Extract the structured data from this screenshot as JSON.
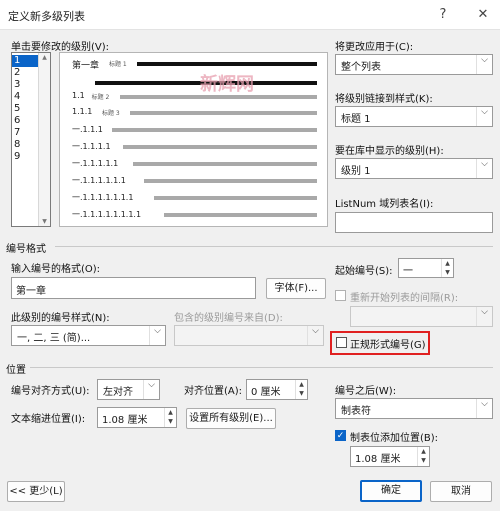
{
  "window": {
    "title": "定义新多级列表",
    "help": "?",
    "close": "✕"
  },
  "level_section": {
    "label": "单击要修改的级别(V):",
    "levels": [
      "1",
      "2",
      "3",
      "4",
      "5",
      "6",
      "7",
      "8",
      "9"
    ],
    "selected_level": "1"
  },
  "preview": {
    "rows": [
      {
        "text": "第一章",
        "style": "标题 1"
      },
      {
        "text": "",
        "style": ""
      },
      {
        "text": "1.1",
        "style": "标题 2"
      },
      {
        "text": "1.1.1",
        "style": "标题 3"
      },
      {
        "text": "一.1.1.1",
        "style": ""
      },
      {
        "text": "一.1.1.1.1",
        "style": ""
      },
      {
        "text": "一.1.1.1.1.1",
        "style": ""
      },
      {
        "text": "一.1.1.1.1.1.1",
        "style": ""
      },
      {
        "text": "一.1.1.1.1.1.1.1",
        "style": ""
      },
      {
        "text": "一.1.1.1.1.1.1.1.1",
        "style": ""
      }
    ]
  },
  "watermark": "新辉网",
  "right_panel": {
    "apply_to_label": "将更改应用于(C):",
    "apply_to_value": "整个列表",
    "link_style_label": "将级别链接到样式(K):",
    "link_style_value": "标题 1",
    "gallery_level_label": "要在库中显示的级别(H):",
    "gallery_level_value": "级别 1",
    "listnum_label": "ListNum 域列表名(I):",
    "listnum_value": ""
  },
  "number_format": {
    "section_title": "编号格式",
    "enter_format_label": "输入编号的格式(O):",
    "enter_format_value": "第一章",
    "font_button": "字体(F)...",
    "start_at_label": "起始编号(S):",
    "start_at_value": "一",
    "restart_label": "重新开始列表的间隔(R):",
    "number_style_label": "此级别的编号样式(N):",
    "number_style_value": "一, 二, 三 (简)...",
    "include_level_label": "包含的级别编号来自(D):",
    "legal_style_label": "正规形式编号(G)"
  },
  "position": {
    "section_title": "位置",
    "alignment_label": "编号对齐方式(U):",
    "alignment_value": "左对齐",
    "aligned_at_label": "对齐位置(A):",
    "aligned_at_value": "0 厘米",
    "follow_label": "编号之后(W):",
    "follow_value": "制表符",
    "indent_label": "文本缩进位置(I):",
    "indent_value": "1.08 厘米",
    "set_all_button": "设置所有级别(E)...",
    "tab_stop_label": "制表位添加位置(B):",
    "tab_stop_checked": true,
    "tab_stop_value": "1.08 厘米"
  },
  "footer": {
    "less_button": "<< 更少(L)",
    "ok_button": "确定",
    "cancel_button": "取消"
  },
  "highlight_color": "#e02020",
  "accent_color": "#0a64c8"
}
